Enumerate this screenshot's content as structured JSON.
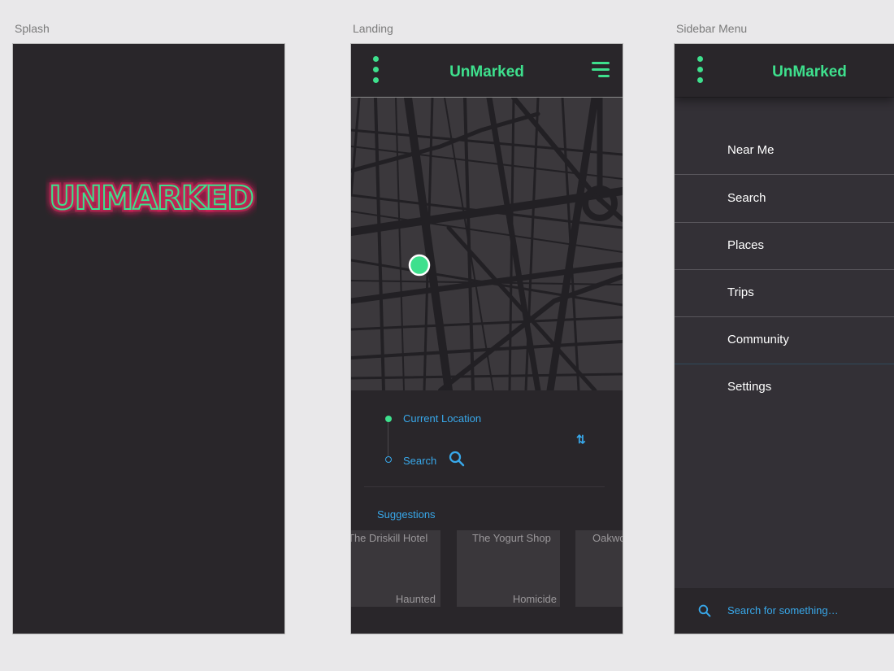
{
  "artboards": {
    "splash": "Splash",
    "landing": "Landing",
    "sidebar": "Sidebar Menu"
  },
  "brand": {
    "name": "UnMarked",
    "accent_color": "#3ee08d",
    "link_color": "#38a8ea",
    "glow_color": "#e0245e",
    "background": "#29262a"
  },
  "splash": {
    "logo_text": "UNMARKED"
  },
  "landing": {
    "route": {
      "origin": "Current Location",
      "destination": "Search",
      "swap_icon": "swap-vertical-icon",
      "search_icon": "search-icon"
    },
    "suggestions_title": "Suggestions",
    "suggestions": [
      {
        "name": "The Driskill Hotel",
        "tag": "Haunted"
      },
      {
        "name": "The Yogurt Shop",
        "tag": "Homicide"
      },
      {
        "name": "Oakwood Cemetery",
        "tag": ""
      }
    ]
  },
  "sidebar_menu": {
    "items": [
      "Near Me",
      "Search",
      "Places",
      "Trips",
      "Community",
      "Settings"
    ],
    "search_placeholder": "Search for something…"
  }
}
